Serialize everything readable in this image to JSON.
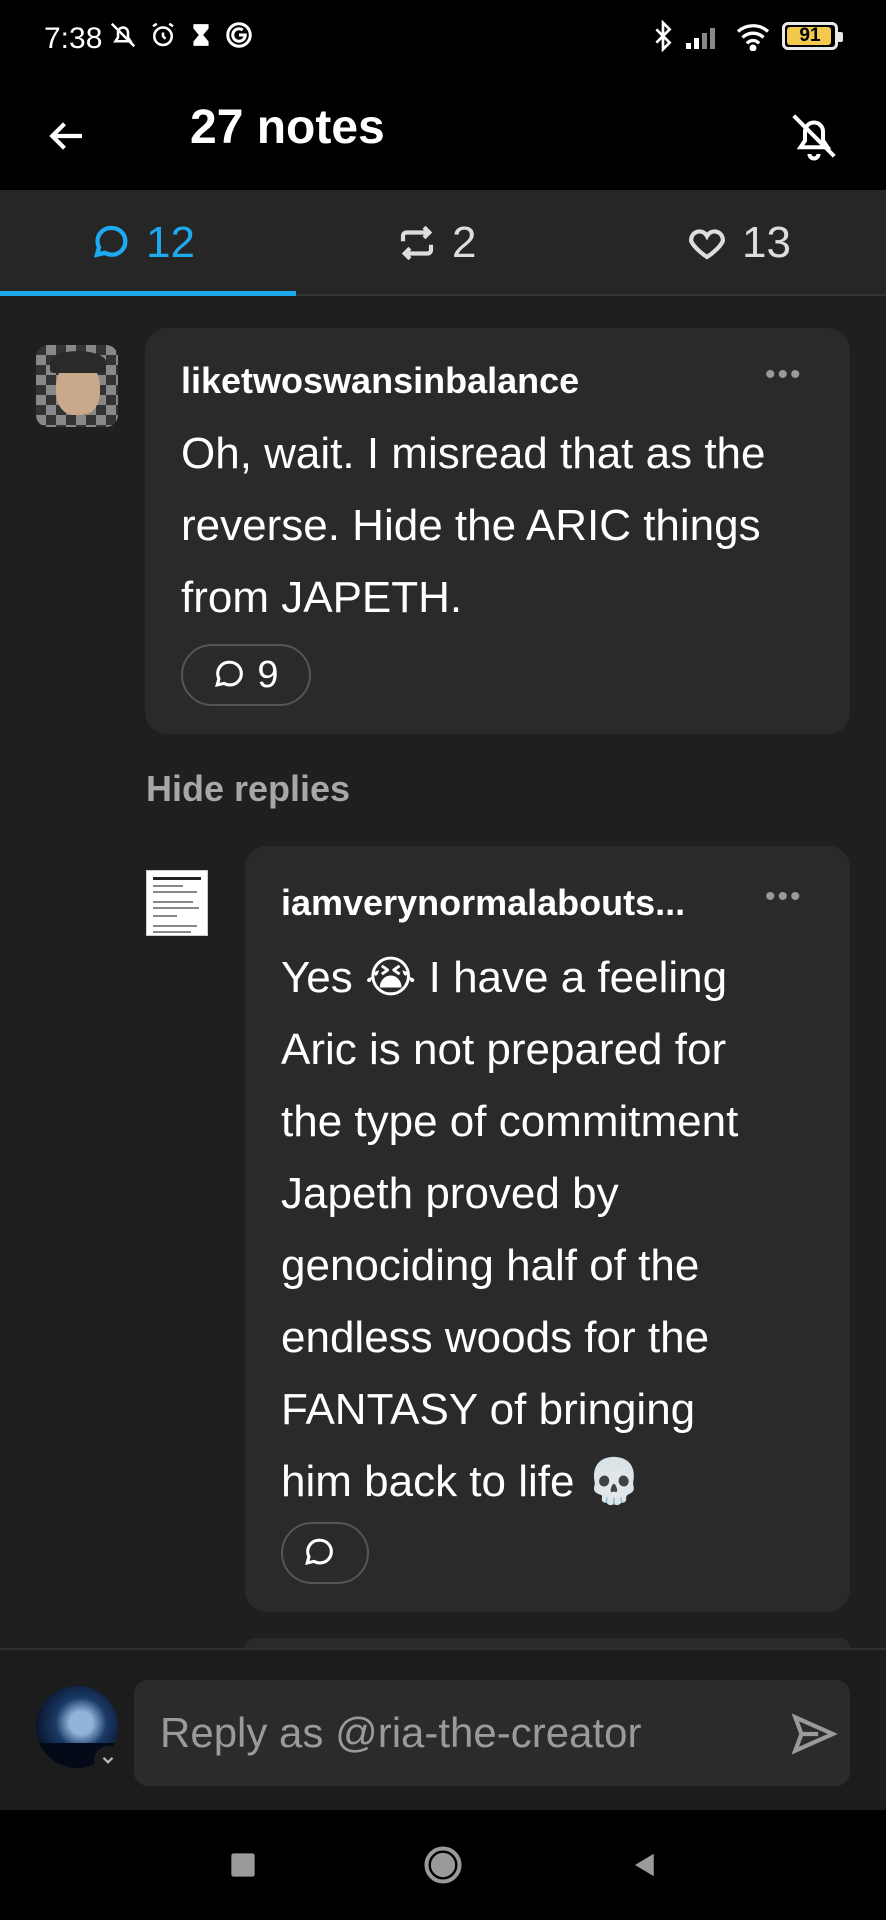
{
  "status_bar": {
    "time": "7:38",
    "battery_level": "91"
  },
  "header": {
    "title": "27 notes"
  },
  "tabs": [
    {
      "name": "comments",
      "count": "12",
      "active": true
    },
    {
      "name": "reblogs",
      "count": "2",
      "active": false
    },
    {
      "name": "likes",
      "count": "13",
      "active": false
    }
  ],
  "comments": [
    {
      "username": "liketwoswansinbalance",
      "text": "Oh, wait. I misread that as the reverse. Hide the ARIC things from JAPETH.",
      "reply_count": "9"
    },
    {
      "username": "iamverynormalabouts...",
      "text_lines": [
        "Yes 😭 I have a feeling",
        "Aric is not prepared for",
        "the type of commitment",
        "Japeth proved by",
        "genociding half of the",
        "endless woods for the",
        "FANTASY of bringing",
        "him back to life 💀"
      ],
      "reply_count": ""
    }
  ],
  "hide_replies_label": "Hide replies",
  "reply_bar": {
    "placeholder": "Reply as @ria-the-creator"
  },
  "colors": {
    "accent": "#1eaaf1",
    "card": "#2a2a2a",
    "background": "#1f1f1f"
  }
}
